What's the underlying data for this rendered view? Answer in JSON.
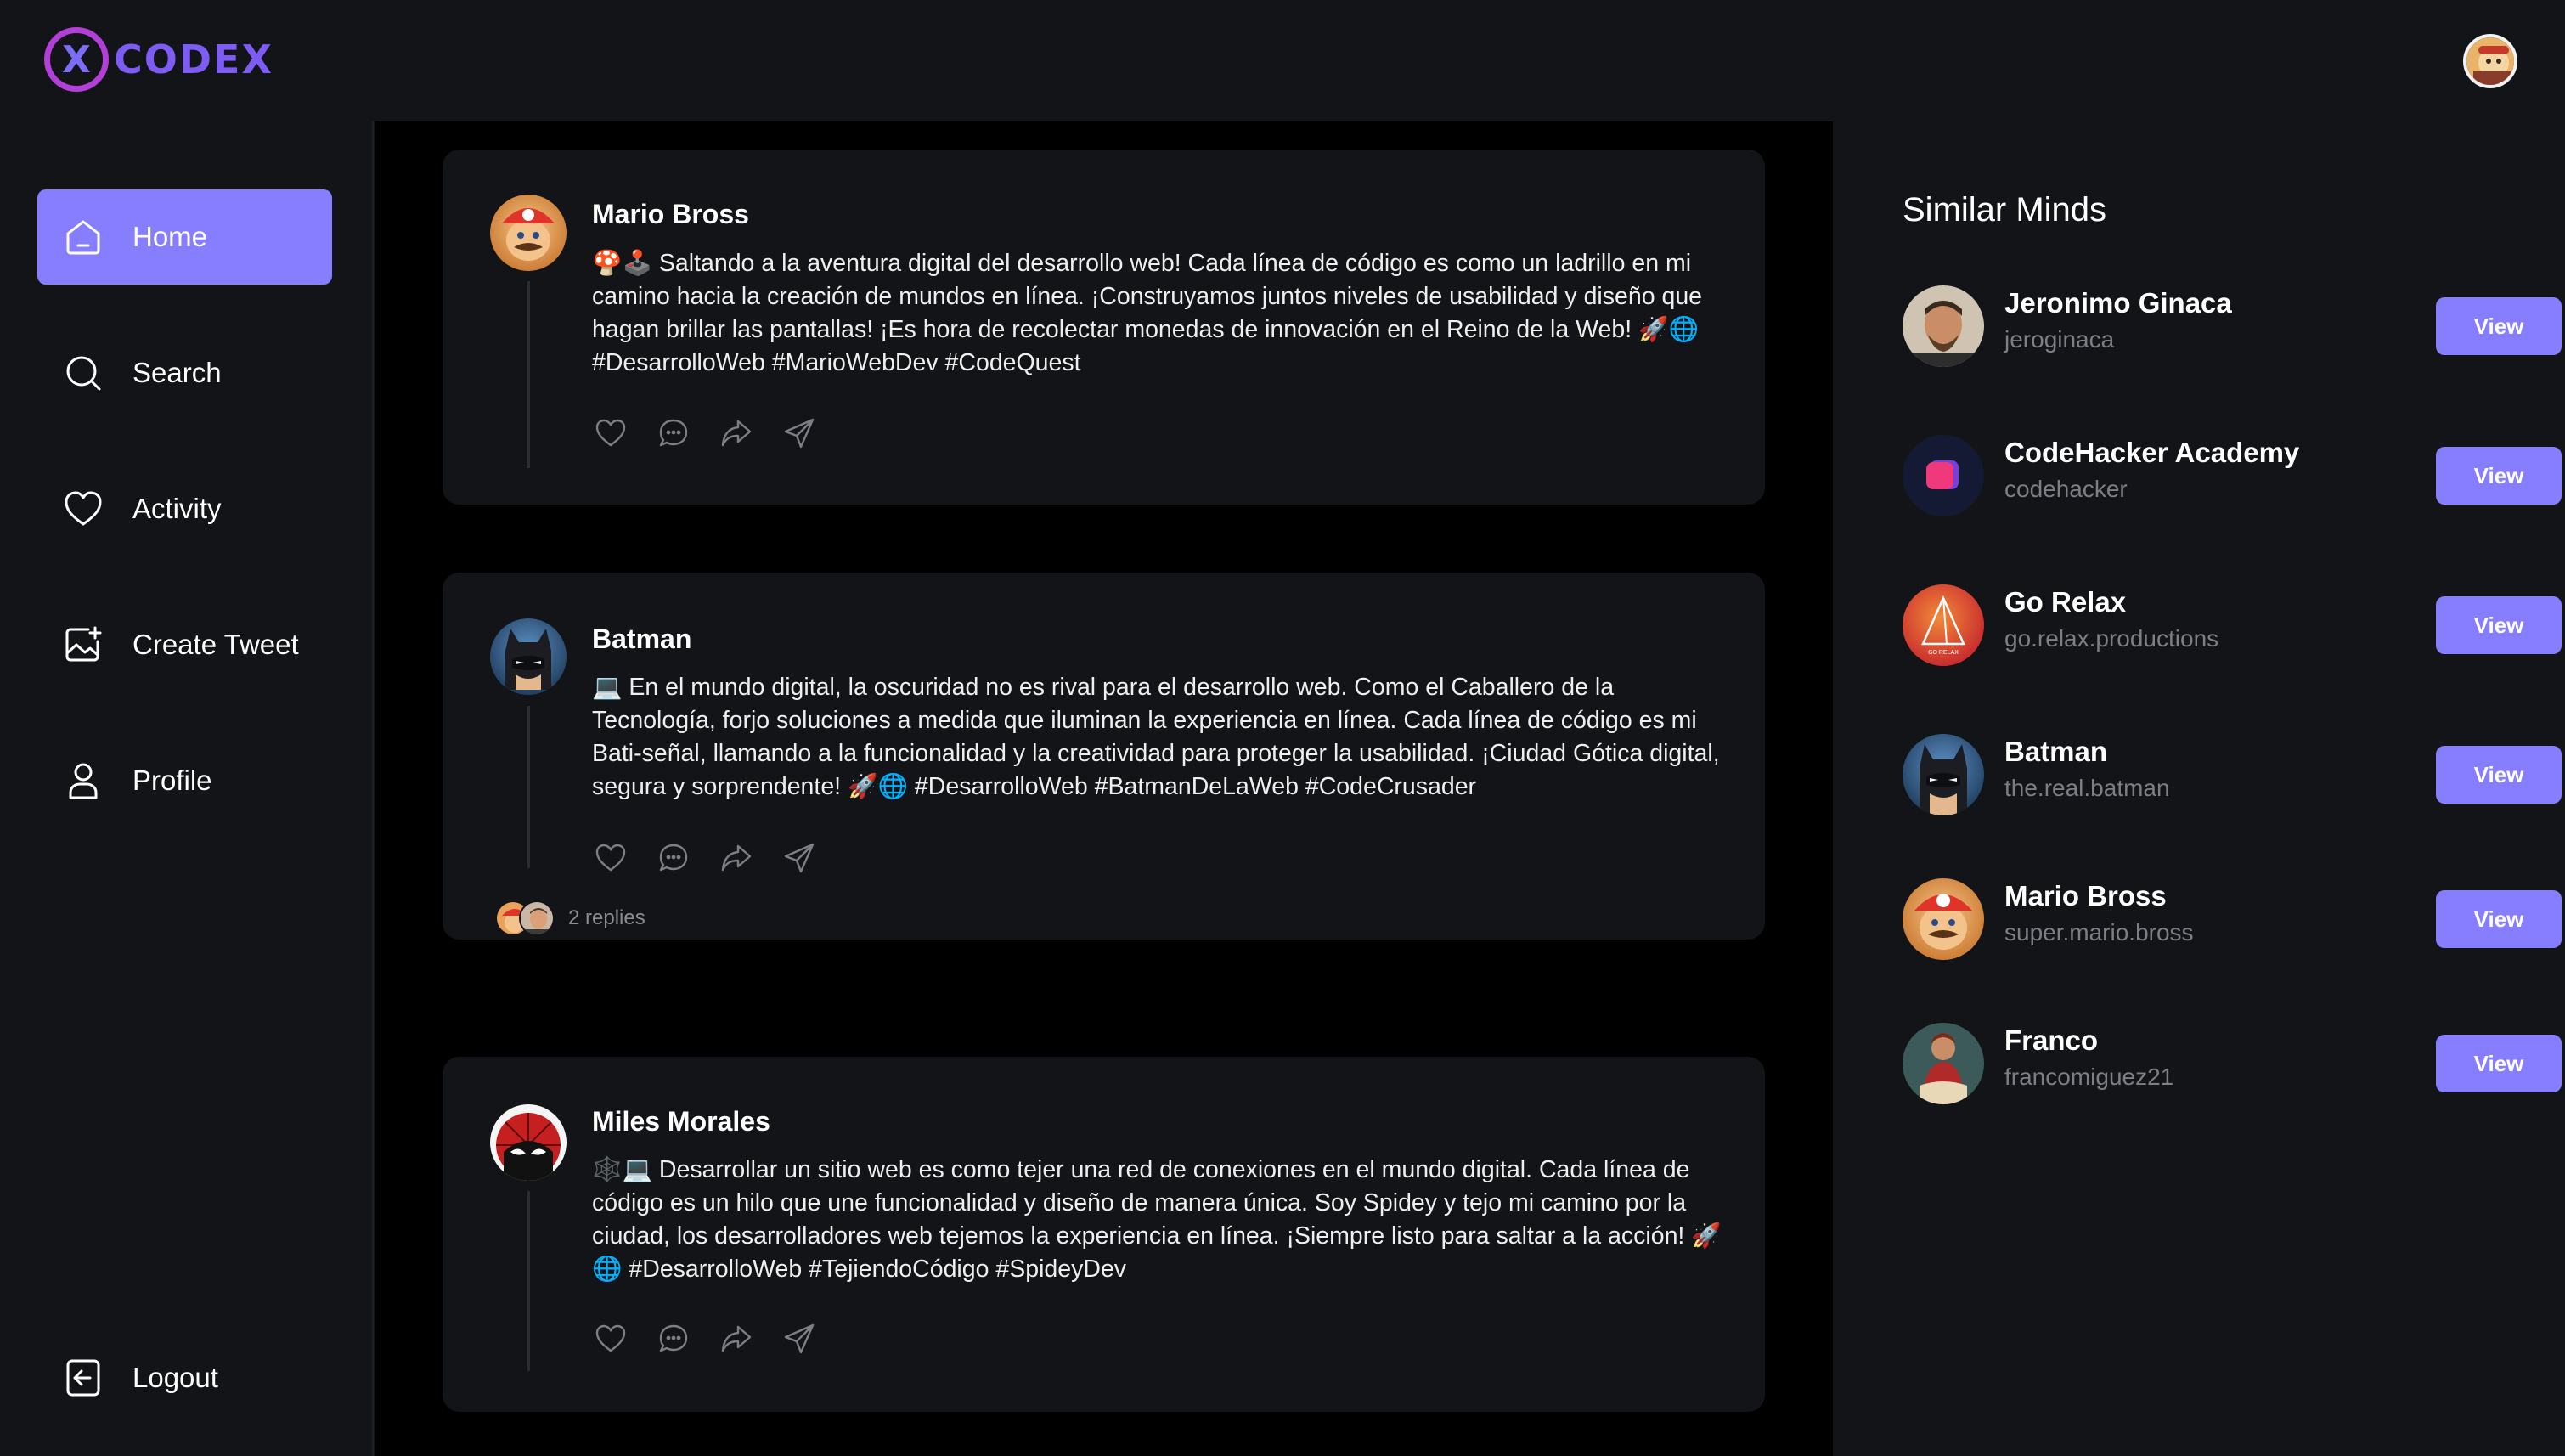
{
  "brand": {
    "mark": "X",
    "name": "CODEX"
  },
  "colors": {
    "accent": "#877eff",
    "background": "#121417",
    "feed_background": "#000000",
    "muted": "#7d7f86"
  },
  "sidebar": {
    "items": [
      {
        "label": "Home",
        "icon": "home-icon",
        "active": true
      },
      {
        "label": "Search",
        "icon": "search-icon",
        "active": false
      },
      {
        "label": "Activity",
        "icon": "heart-icon",
        "active": false
      },
      {
        "label": "Create Tweet",
        "icon": "image-plus-icon",
        "active": false
      },
      {
        "label": "Profile",
        "icon": "user-icon",
        "active": false
      }
    ],
    "logout": {
      "label": "Logout",
      "icon": "logout-icon"
    }
  },
  "feed": {
    "posts": [
      {
        "author": "Mario Bross",
        "text": "🍄🕹️ Saltando a la aventura digital del desarrollo web! Cada línea de código es como un ladrillo en mi camino hacia la creación de mundos en línea. ¡Construyamos juntos niveles de usabilidad y diseño que hagan brillar las pantallas! ¡Es hora de recolectar monedas de innovación en el Reino de la Web! 🚀🌐 #DesarrolloWeb #MarioWebDev #CodeQuest"
      },
      {
        "author": "Batman",
        "text": "💻 En el mundo digital, la oscuridad no es rival para el desarrollo web. Como el Caballero de la Tecnología, forjo soluciones a medida que iluminan la experiencia en línea. Cada línea de código es mi Bati-señal, llamando a la funcionalidad y la creatividad para proteger la usabilidad. ¡Ciudad Gótica digital, segura y sorprendente! 🚀🌐 #DesarrolloWeb #BatmanDeLaWeb #CodeCrusader",
        "replies": "2 replies"
      },
      {
        "author": "Miles Morales",
        "text": "🕸️💻 Desarrollar un sitio web es como tejer una red de conexiones en el mundo digital. Cada línea de código es un hilo que une funcionalidad y diseño de manera única. Soy Spidey y tejo mi camino por la ciudad, los desarrolladores web tejemos la experiencia en línea. ¡Siempre listo para saltar a la acción! 🚀🌐 #DesarrolloWeb #TejiendoCódigo #SpideyDev"
      }
    ]
  },
  "similar_minds": {
    "title": "Similar Minds",
    "button_label": "View",
    "people": [
      {
        "name": "Jeronimo Ginaca",
        "username": "jeroginaca"
      },
      {
        "name": "CodeHacker Academy",
        "username": "codehacker"
      },
      {
        "name": "Go Relax",
        "username": "go.relax.productions",
        "logo_text": "GO RELAX"
      },
      {
        "name": "Batman",
        "username": "the.real.batman"
      },
      {
        "name": "Mario Bross",
        "username": "super.mario.bross"
      },
      {
        "name": "Franco",
        "username": "francomiguez21"
      }
    ]
  }
}
